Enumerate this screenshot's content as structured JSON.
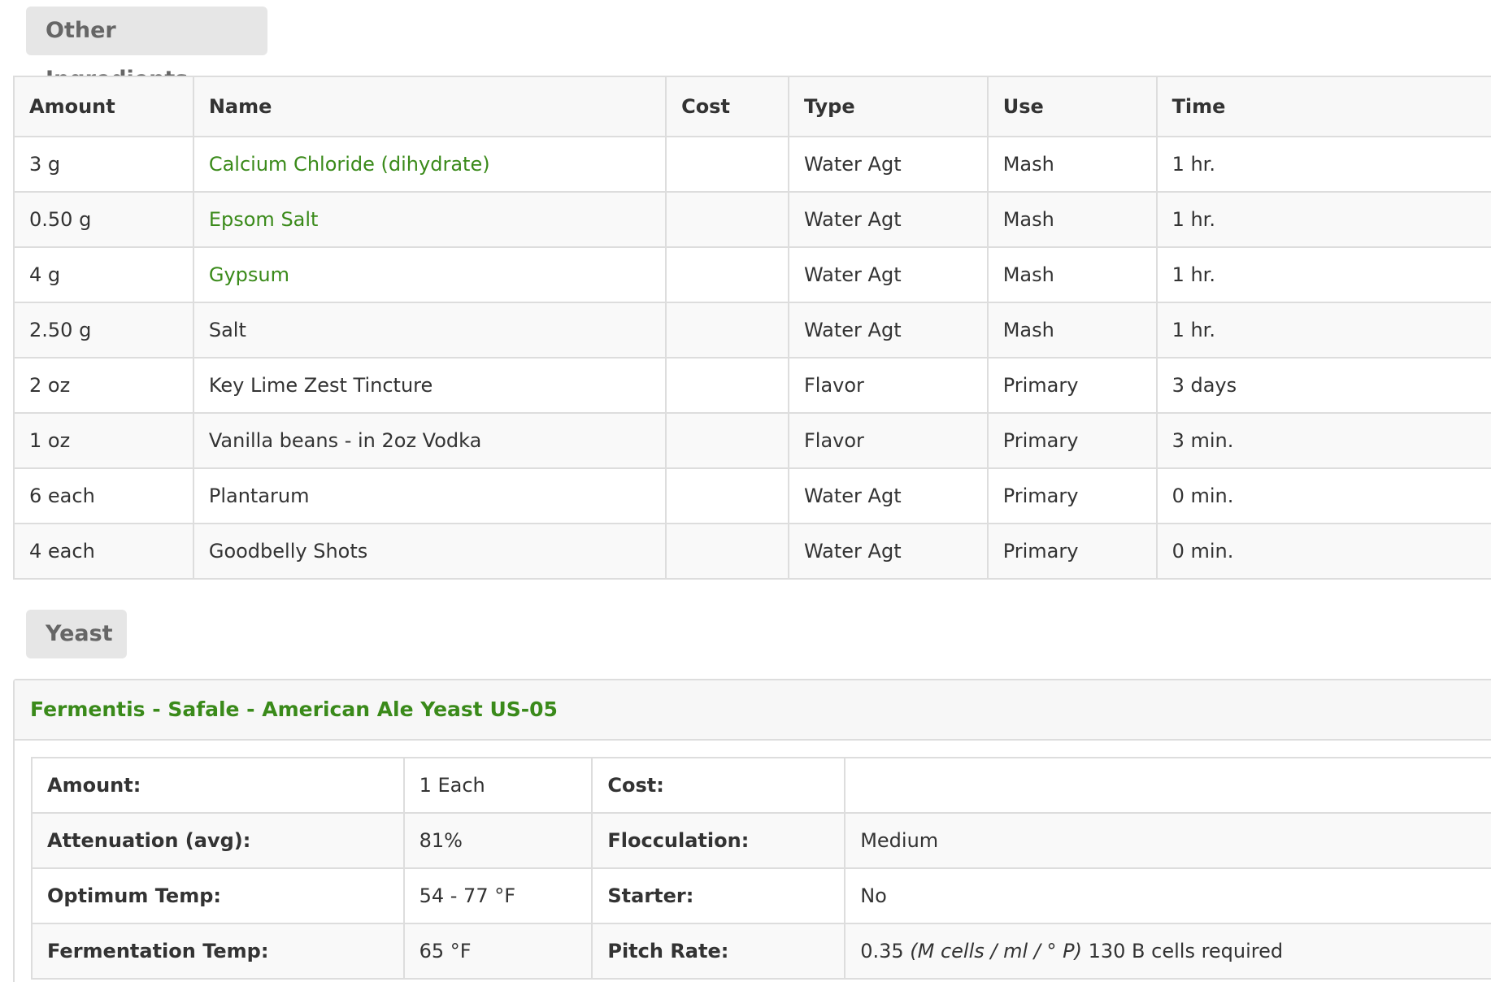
{
  "ingredients_section": {
    "title": "Other Ingredients",
    "columns": [
      "Amount",
      "Name",
      "Cost",
      "Type",
      "Use",
      "Time"
    ],
    "rows": [
      {
        "amount": "3 g",
        "name": "Calcium Chloride (dihydrate)",
        "cost": "",
        "type": "Water Agt",
        "use": "Mash",
        "time": "1 hr."
      },
      {
        "amount": "0.50 g",
        "name": "Epsom Salt",
        "cost": "",
        "type": "Water Agt",
        "use": "Mash",
        "time": "1 hr."
      },
      {
        "amount": "4 g",
        "name": "Gypsum",
        "cost": "",
        "type": "Water Agt",
        "use": "Mash",
        "time": "1 hr."
      },
      {
        "amount": "2.50 g",
        "name": "Salt",
        "cost": "",
        "type": "Water Agt",
        "use": "Mash",
        "time": "1 hr."
      },
      {
        "amount": "2 oz",
        "name": "Key Lime Zest Tincture",
        "cost": "",
        "type": "Flavor",
        "use": "Primary",
        "time": "3 days"
      },
      {
        "amount": "1 oz",
        "name": "Vanilla beans - in 2oz Vodka",
        "cost": "",
        "type": "Flavor",
        "use": "Primary",
        "time": "3 min."
      },
      {
        "amount": "6 each",
        "name": "Plantarum",
        "cost": "",
        "type": "Water Agt",
        "use": "Primary",
        "time": "0 min."
      },
      {
        "amount": "4 each",
        "name": "Goodbelly Shots",
        "cost": "",
        "type": "Water Agt",
        "use": "Primary",
        "time": "0 min."
      }
    ]
  },
  "yeast_section": {
    "title": "Yeast",
    "yeast_name": "Fermentis - Safale - American Ale Yeast US-05",
    "details": {
      "amount_label": "Amount:",
      "amount_value": "1 Each",
      "cost_label": "Cost:",
      "cost_value": "",
      "attenuation_label": "Attenuation (avg):",
      "attenuation_value": "81%",
      "flocculation_label": "Flocculation:",
      "flocculation_value": "Medium",
      "optimum_temp_label": "Optimum Temp:",
      "optimum_temp_value": "54 - 77 °F",
      "starter_label": "Starter:",
      "starter_value": "No",
      "fermentation_temp_label": "Fermentation Temp:",
      "fermentation_temp_value": "65 °F",
      "pitch_rate_label": "Pitch Rate:",
      "pitch_rate_number": "0.35",
      "pitch_rate_units": "(M cells / ml / ° P)",
      "pitch_rate_cells": "130 B cells required"
    }
  },
  "colors": {
    "link_green": "#3a8a1a",
    "pill_bg": "#e6e6e6",
    "border": "#dddddd"
  }
}
